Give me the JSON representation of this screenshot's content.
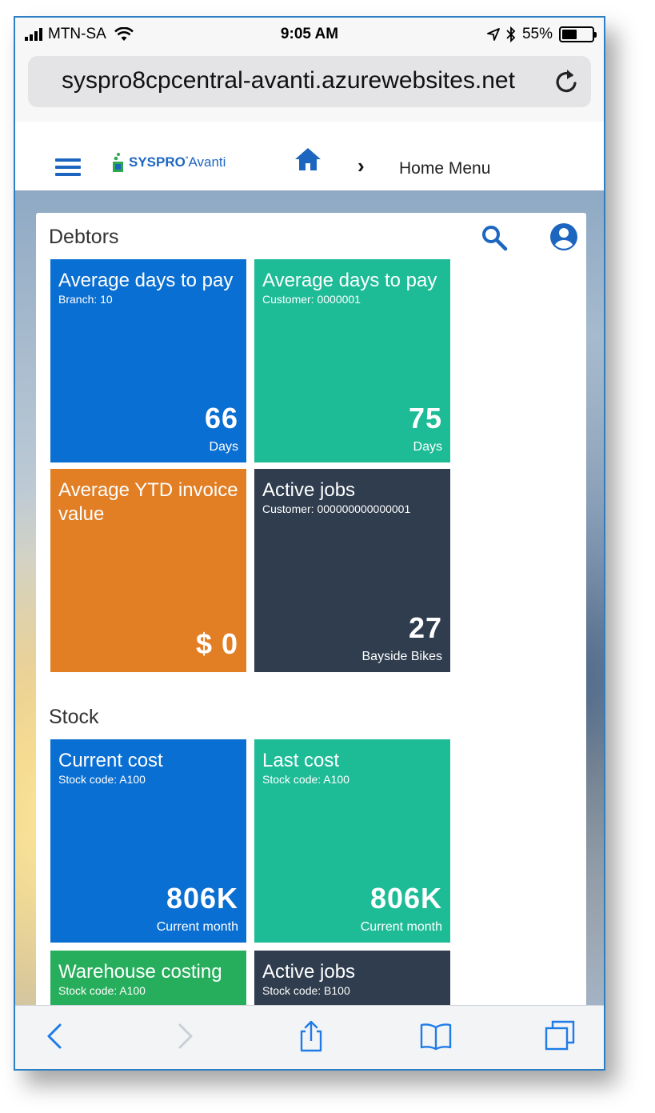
{
  "status_bar": {
    "carrier": "MTN-SA",
    "time": "9:05 AM",
    "battery": "55%",
    "battery_level": 0.55
  },
  "browser": {
    "url": "syspro8cpcentral-avanti.azurewebsites.net"
  },
  "header": {
    "logo_brand": "SYSPRO",
    "logo_product": "Avanti",
    "breadcrumb": "Home Menu"
  },
  "sections": {
    "debtors": {
      "title": "Debtors",
      "tiles": [
        {
          "title": "Average days to pay",
          "subtitle": "Branch: 10",
          "value": "66",
          "unit": "Days",
          "color": "#0a6fd2"
        },
        {
          "title": "Average days to pay",
          "subtitle": "Customer: 0000001",
          "value": "75",
          "unit": "Days",
          "color": "#1dbc97"
        },
        {
          "title": "Average YTD invoice value",
          "subtitle": "",
          "value": "$ 0",
          "unit": "",
          "color": "#e27f25"
        },
        {
          "title": "Active jobs",
          "subtitle": "Customer: 000000000000001",
          "value": "27",
          "unit": "Bayside Bikes",
          "color": "#2f3d4e"
        }
      ]
    },
    "stock": {
      "title": "Stock",
      "tiles": [
        {
          "title": "Current cost",
          "subtitle": "Stock code: A100",
          "value": "806K",
          "unit": "Current month",
          "color": "#0a6fd2"
        },
        {
          "title": "Last cost",
          "subtitle": "Stock code: A100",
          "value": "806K",
          "unit": "Current month",
          "color": "#1dbc97"
        },
        {
          "title": "Warehouse costing",
          "subtitle": "Stock code: A100",
          "value": "",
          "unit": "",
          "color": "#27ae5c"
        },
        {
          "title": "Active jobs",
          "subtitle": "Stock code: B100",
          "value": "",
          "unit": "",
          "color": "#2f3d4e"
        }
      ]
    }
  },
  "toolbar": {
    "icons": [
      "back-icon",
      "forward-icon",
      "share-icon",
      "bookmarks-icon",
      "tabs-icon"
    ]
  }
}
